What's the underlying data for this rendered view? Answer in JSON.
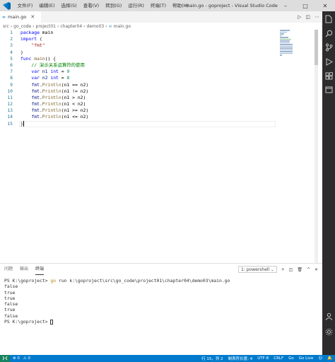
{
  "titlebar": {
    "menu": [
      "文件(F)",
      "编辑(E)",
      "选择(S)",
      "查看(V)",
      "转到(G)",
      "运行(R)",
      "终端(T)",
      "帮助(H)"
    ],
    "title": "main.go - goproject - Visual Studio Code"
  },
  "tab": {
    "label": "main.go"
  },
  "breadcrumb": [
    "src",
    "go_code",
    "project01",
    "chapter04",
    "demo03",
    "main.go"
  ],
  "editor": {
    "line_numbers": [
      "1",
      "2",
      "3",
      "4",
      "5",
      "6",
      "7",
      "8",
      "9",
      "10",
      "11",
      "12",
      "13",
      "14",
      "15"
    ]
  },
  "panel": {
    "tabs": [
      "问题",
      "输出",
      "终端"
    ],
    "shell": "1: powershell",
    "terminal": {
      "prompt1": "PS K:\\goproject> ",
      "cmd_go": "go",
      "cmd_rest": " run k:\\goproject\\src\\go_code\\project01\\chapter04\\demo03\\main.go",
      "outputs": [
        "false",
        "true",
        "true",
        "false",
        "true",
        "false"
      ],
      "prompt2": "PS K:\\goproject> "
    }
  },
  "statusbar": {
    "position": "行 15，列 2",
    "tabsize": "制表符长度: 4",
    "encoding": "UTF-8",
    "eol": "CRLF",
    "language": "Go",
    "golive": "Go Live"
  }
}
